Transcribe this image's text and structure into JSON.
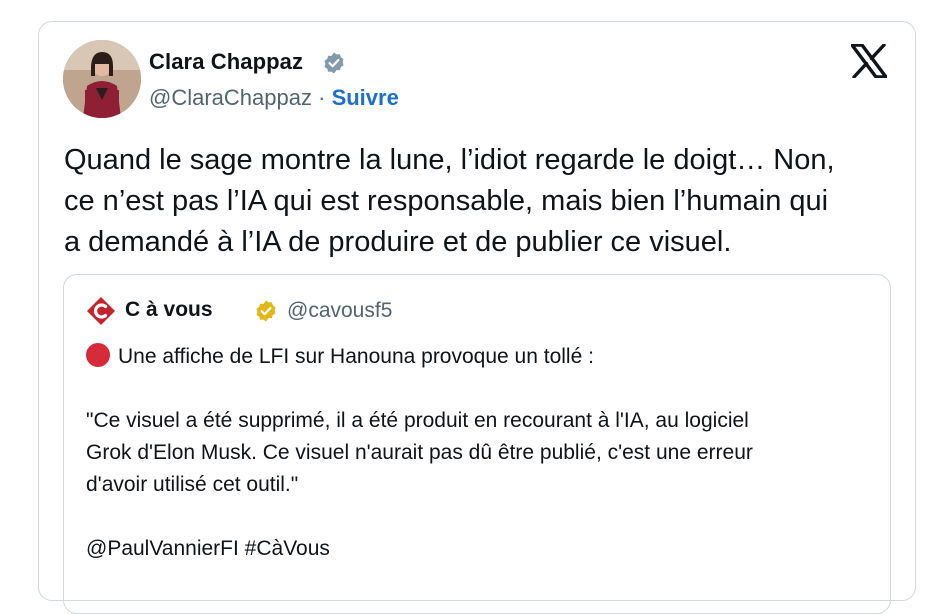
{
  "post": {
    "author_name": "Clara Chappaz",
    "author_handle": "@ClaraChappaz",
    "separator": "·",
    "follow_label": "Suivre",
    "text_lines": [
      "Quand le sage montre la lune, l’idiot regarde le doigt… Non,",
      "ce n’est pas l’IA qui est responsable, mais bien l’humain qui",
      "a demandé à l’IA de produire et de publier ce visuel."
    ],
    "icons": {
      "verified": "verified-badge-icon",
      "platform": "x-logo-icon"
    }
  },
  "quoted": {
    "author_name": "C à vous",
    "author_handle": "@cavousf5",
    "icons": {
      "logo": "c-a-vous-logo-icon",
      "verified": "gold-verified-badge-icon",
      "bullet": "red-circle-icon"
    },
    "headline": "Une affiche de LFI sur Hanouna provoque un tollé :",
    "quote_lines": [
      "\"Ce visuel a été supprimé, il a été produit en recourant à l'IA, au logiciel",
      "Grok d'Elon Musk. Ce visuel n'aurait pas dû être publié, c'est une erreur",
      "d'avoir utilisé cet outil.\""
    ],
    "mentions": "@PaulVannierFI #CàVous"
  },
  "colors": {
    "link": "#1d6fcc",
    "secondary_text": "#536471",
    "border": "#cfd9de",
    "verified_blue": "#829aab",
    "verified_gold": "#e2b719",
    "brand_red": "#c4242c"
  }
}
